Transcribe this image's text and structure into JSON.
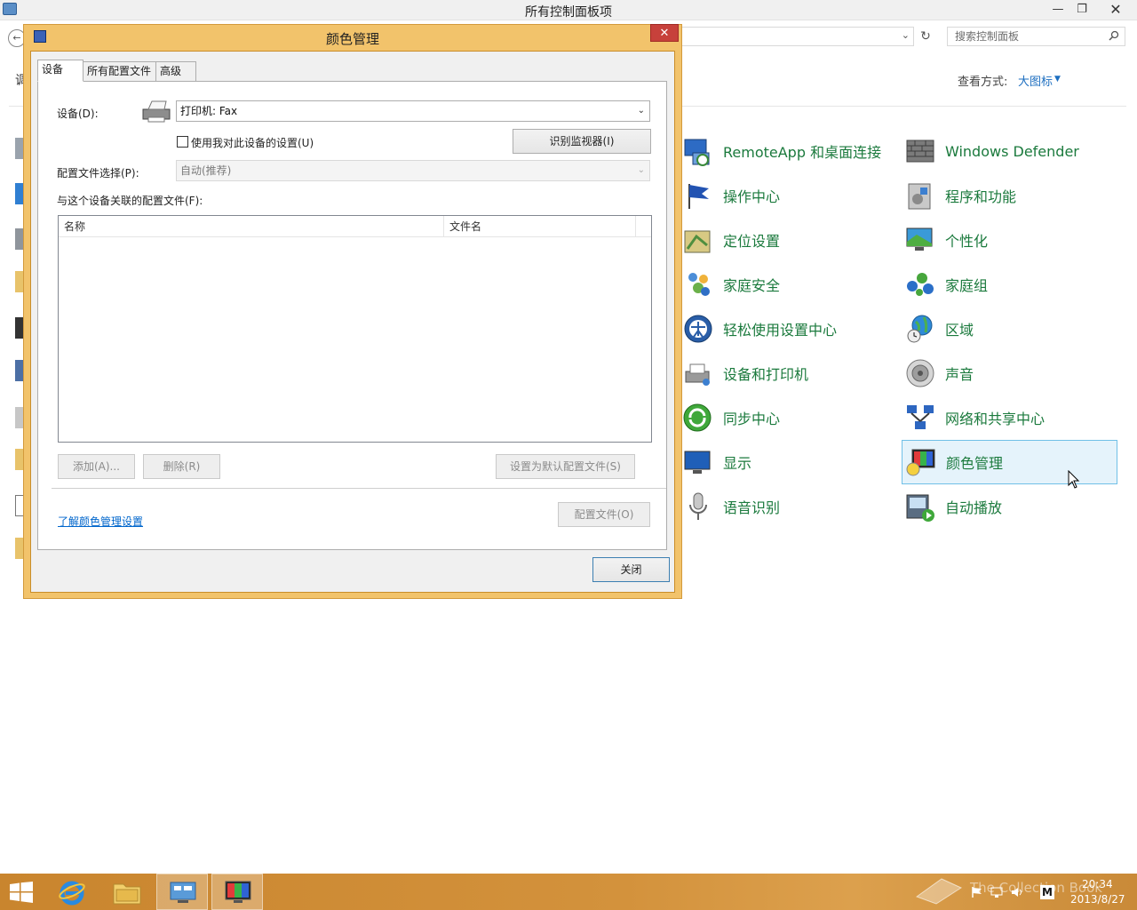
{
  "window": {
    "title": "所有控制面板项",
    "minimize": "—",
    "restore": "❐",
    "close": "✕"
  },
  "nav": {
    "back": "←",
    "refresh": "↻",
    "search_placeholder": "搜索控制面板",
    "left_partial": "调"
  },
  "view": {
    "label": "查看方式:",
    "value": "大图标",
    "caret": "▼"
  },
  "items_col1": [
    {
      "label": "RemoteApp 和桌面连接",
      "icon": "remoteapp-icon"
    },
    {
      "label": "操作中心",
      "icon": "action-center-flag-icon"
    },
    {
      "label": "定位设置",
      "icon": "location-icon"
    },
    {
      "label": "家庭安全",
      "icon": "family-safety-icon"
    },
    {
      "label": "轻松使用设置中心",
      "icon": "ease-of-access-icon"
    },
    {
      "label": "设备和打印机",
      "icon": "devices-printers-icon"
    },
    {
      "label": "同步中心",
      "icon": "sync-center-icon"
    },
    {
      "label": "显示",
      "icon": "display-icon"
    },
    {
      "label": "语音识别",
      "icon": "microphone-icon"
    }
  ],
  "items_col2": [
    {
      "label": "Windows Defender",
      "icon": "defender-wall-icon"
    },
    {
      "label": "程序和功能",
      "icon": "programs-features-icon"
    },
    {
      "label": "个性化",
      "icon": "personalization-icon"
    },
    {
      "label": "家庭组",
      "icon": "homegroup-icon"
    },
    {
      "label": "区域",
      "icon": "region-globe-icon"
    },
    {
      "label": "声音",
      "icon": "speaker-icon"
    },
    {
      "label": "网络和共享中心",
      "icon": "network-icon"
    },
    {
      "label": "颜色管理",
      "icon": "color-management-icon"
    },
    {
      "label": "自动播放",
      "icon": "autoplay-icon"
    }
  ],
  "dialog": {
    "title": "颜色管理",
    "close": "✕",
    "tabs": [
      "设备",
      "所有配置文件",
      "高级"
    ],
    "device_label": "设备(D):",
    "device_value": "打印机: Fax",
    "use_my_settings": "使用我对此设备的设置(U)",
    "identify_monitors": "识别监视器(I)",
    "profile_selection_label": "配置文件选择(P):",
    "profile_selection_value": "自动(推荐)",
    "associated_label": "与这个设备关联的配置文件(F):",
    "columns": [
      "名称",
      "文件名"
    ],
    "add": "添加(A)...",
    "remove": "删除(R)",
    "set_default": "设置为默认配置文件(S)",
    "profiles": "配置文件(O)",
    "learn_link": "了解颜色管理设置",
    "close_button": "关闭",
    "dropdown_caret": "⌄"
  },
  "taskbar": {
    "time": "20:34",
    "date": "2013/8/27",
    "watermark": "The Collection Book"
  }
}
